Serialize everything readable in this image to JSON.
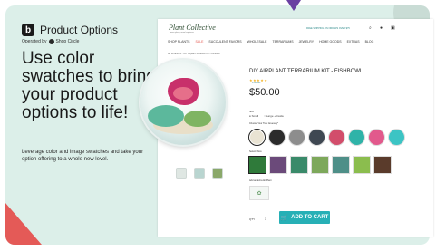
{
  "brand": {
    "name": "Product Options",
    "logo_letter": "b",
    "operated_by": "Operated by",
    "operated_company": "Shop Circle"
  },
  "headline": "Use color swatches to bring your product options to life!",
  "subtext": "Leverage color and image swatches and take your option offering to a whole new level.",
  "store": {
    "logo": "Plant Collective",
    "logo_sub": "more plants, more happiness",
    "promo": "FREE SHIPPING ON ORDERS OVER $75",
    "nav": [
      "SHOP PLANTS",
      "SALE",
      "SUCCULENT FAVORS",
      "WHOLESALE",
      "TERRARIUMS",
      "JEWELRY",
      "HOME GOODS",
      "EXTRAS",
      "BLOG"
    ],
    "breadcrumb": "All Terrariums · DIY Airplant Terrarium Kit - Fishbowl"
  },
  "product": {
    "title": "DIY AIRPLANT TERRARIUM KIT - FISHBOWL",
    "stars": "★★★★★",
    "reviews": "9 Reviews",
    "price": "$50.00",
    "size_label": "Size",
    "size_options": [
      "Small",
      "Large + Inside"
    ],
    "greenery_label": "Choose Your Tree Greenery*",
    "swatch_colors": [
      "#e9e3d3",
      "#2b2b2b",
      "#8d8d8d",
      "#3f4852",
      "#d24d6b",
      "#2fb3a8",
      "#e2598c",
      "#3cc4c4"
    ],
    "moss_label": "Select Moss",
    "moss_colors": [
      "#2f7a3a",
      "#6b4a7a",
      "#3a8a6a",
      "#7da85b",
      "#4e8f88",
      "#8bbd4e",
      "#5a3b2b"
    ],
    "add_plant_label": "Add an Extra Air Plant",
    "qty_label": "QTY",
    "qty": "1",
    "add_to_cart": "ADD TO CART"
  }
}
